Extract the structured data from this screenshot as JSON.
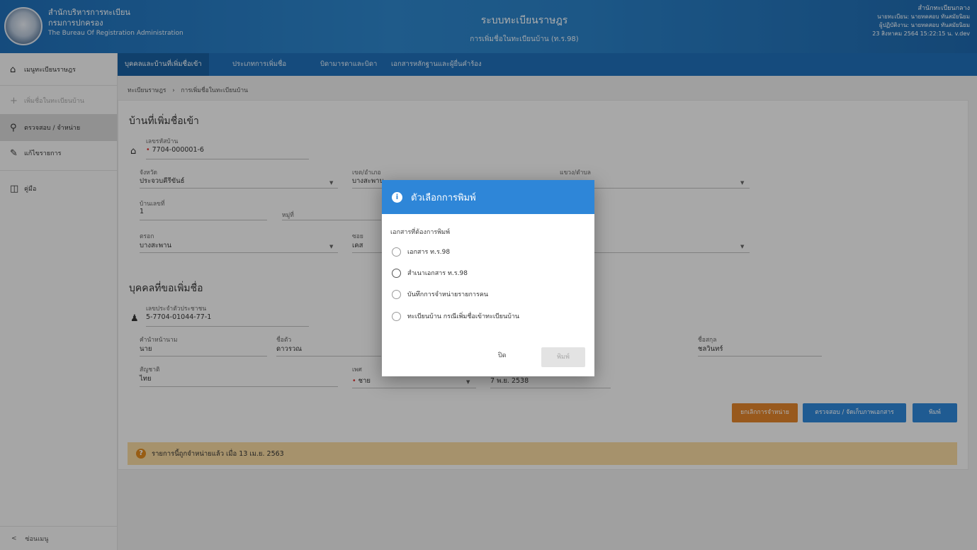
{
  "header": {
    "org_line1": "สำนักบริหารการทะเบียน",
    "org_line2": "กรมการปกครอง",
    "org_line3": "The Bureau Of Registration Administration",
    "system_title": "ระบบทะเบียนราษฎร",
    "system_subtitle": "การเพิ่มชื่อในทะเบียนบ้าน (ท.ร.98)",
    "user_office": "สำนักทะเบียนกลาง",
    "user_line1": "นายทะเบียน: นายทดสอบ ทันสมัยนิยม",
    "user_line2": "ผู้ปฏิบัติงาน: นายทดสอบ ทันสมัยนิยม",
    "user_datetime": "23 สิงหาคม 2564 15:22:15 น.  v.dev"
  },
  "tabs": [
    {
      "label": "บุคคลและบ้านที่เพิ่มชื่อเข้า"
    },
    {
      "label": "ประเภทการเพิ่มชื่อ"
    },
    {
      "label": "บิดามารดาและบิดา"
    },
    {
      "label": "เอกสารหลักฐานและผู้ยื่นคำร้อง"
    }
  ],
  "sidebar": {
    "items": [
      {
        "label": "เมนูทะเบียนราษฎร"
      },
      {
        "label": "เพิ่มชื่อในทะเบียนบ้าน"
      },
      {
        "label": "ตรวจสอบ / จำหน่าย"
      },
      {
        "label": "แก้ไขรายการ"
      },
      {
        "label": "คู่มือ"
      }
    ],
    "collapse_label": "ซ่อนเมนู"
  },
  "breadcrumb": {
    "root": "ทะเบียนราษฎร",
    "sep": "›",
    "current": "การเพิ่มชื่อในทะเบียนบ้าน"
  },
  "house": {
    "title": "บ้านที่เพิ่มชื่อเข้า",
    "house_no_label": "เลขรหัสบ้าน",
    "house_no": "7704-000001-6",
    "province_label": "จังหวัด",
    "province": "ประจวบคีรีขันธ์",
    "district_label": "เขต/อำเภอ",
    "district": "บางสะพาน",
    "subdistrict_label": "แขวง/ตำบล",
    "subdistrict": "",
    "address_no_label": "บ้านเลขที่",
    "address_no": "1",
    "moo_label": "หมู่ที่",
    "alley_label": "ตรอก",
    "alley": "บางสะพาน",
    "soi_label": "ซอย",
    "soi": "เคส"
  },
  "person": {
    "title": "บุคคลที่ขอเพิ่มชื่อ",
    "id_label": "เลขประจำตัวประชาชน",
    "id": "5-7704-01044-77-1",
    "prefix_label": "คำนำหน้านาม",
    "prefix": "นาย",
    "firstname_label": "ชื่อตัว",
    "firstname": "ดาวรวณ",
    "lastname_label": "ชื่อสกุล",
    "lastname": "ชลวินทร์",
    "nationality_label": "สัญชาติ",
    "nationality": "ไทย",
    "gender_label": "เพศ",
    "gender": "ชาย",
    "birthdate": "7 พ.ย. 2538"
  },
  "buttons": {
    "cancel_discharge": "ยกเลิกการจำหน่าย",
    "check_docs": "ตรวจสอบ / จัดเก็บภาพเอกสาร",
    "print": "พิมพ์"
  },
  "notice": {
    "text": "รายการนี้ถูกจำหน่ายแล้ว เมื่อ 13 เม.ย. 2563"
  },
  "dialog": {
    "title": "ตัวเลือกการพิมพ์",
    "subtitle": "เอกสารที่ต้องการพิมพ์",
    "options": [
      {
        "label": "เอกสาร ท.ร.98"
      },
      {
        "label": "สำเนาเอกสาร ท.ร.98"
      },
      {
        "label": "บันทึกการจำหน่ายรายการคน"
      },
      {
        "label": "ทะเบียนบ้าน กรณีเพิ่มชื่อเข้าทะเบียนบ้าน"
      }
    ],
    "close_label": "ปิด",
    "print_label": "พิมพ์"
  }
}
